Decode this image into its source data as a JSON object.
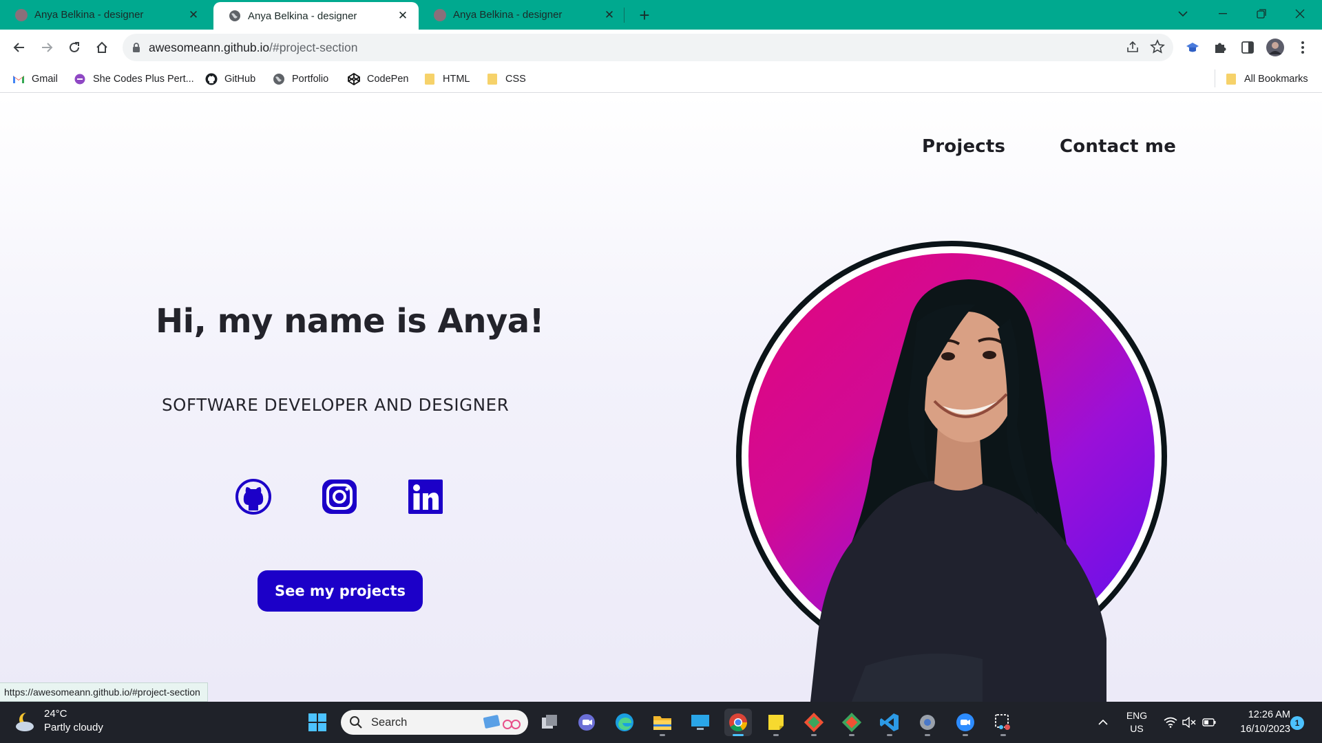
{
  "browser": {
    "tabs": [
      {
        "title": "Anya Belkina - designer",
        "active": false
      },
      {
        "title": "Anya Belkina - designer",
        "active": true
      },
      {
        "title": "Anya Belkina - designer",
        "active": false
      }
    ],
    "url_host": "awesomeann.github.io",
    "url_path": "/#project-section",
    "bookmarks": [
      {
        "label": "Gmail",
        "icon": "gmail-icon"
      },
      {
        "label": "She Codes Plus Pert...",
        "icon": "shecodes-icon"
      },
      {
        "label": "GitHub",
        "icon": "github-icon"
      },
      {
        "label": "Portfolio",
        "icon": "globe-icon"
      },
      {
        "label": "CodePen",
        "icon": "codepen-icon"
      },
      {
        "label": "HTML",
        "icon": "folder-icon"
      },
      {
        "label": "CSS",
        "icon": "folder-icon"
      }
    ],
    "all_bookmarks": "All Bookmarks",
    "status_url": "https://awesomeann.github.io/#project-section"
  },
  "page": {
    "nav": {
      "projects": "Projects",
      "contact": "Contact me"
    },
    "title": "Hi, my name is Anya!",
    "subtitle": "SOFTWARE DEVELOPER AND DESIGNER",
    "social": [
      "github-icon",
      "instagram-icon",
      "linkedin-icon"
    ],
    "cta": "See my projects",
    "accent_color": "#1c00c8",
    "portrait_gradient": [
      "#e3067b",
      "#5b11ef"
    ]
  },
  "taskbar": {
    "temperature": "24°C",
    "weather": "Partly cloudy",
    "search_placeholder": "Search",
    "language": "ENG",
    "region": "US",
    "time": "12:26 AM",
    "date": "16/10/2023",
    "notifications": "1"
  }
}
